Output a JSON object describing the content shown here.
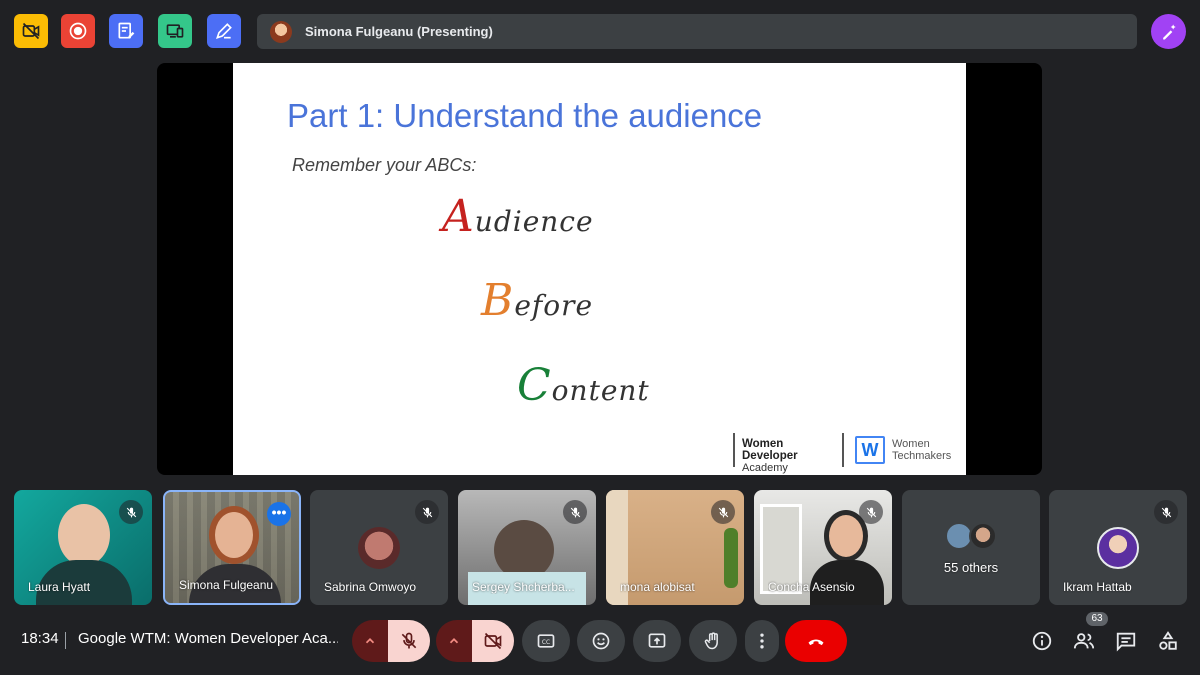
{
  "toolbar": {
    "buttons": [
      {
        "name": "no-video-icon",
        "color": "#fbbc04"
      },
      {
        "name": "record-icon",
        "color": "#ea4335"
      },
      {
        "name": "notes-icon",
        "color": "#4c6ef5"
      },
      {
        "name": "devices-icon",
        "color": "#34c78a"
      },
      {
        "name": "pen-icon",
        "color": "#4c6ef5"
      }
    ],
    "presenter": "Simona Fulgeanu (Presenting)",
    "magic_icon": "sparkle-pen-icon"
  },
  "slide": {
    "title": "Part 1: Understand the audience",
    "subtitle": "Remember your ABCs:",
    "abc": [
      {
        "cap": "A",
        "rest": "udience",
        "color": "#c5221f"
      },
      {
        "cap": "B",
        "rest": "efore",
        "color": "#e37f2e"
      },
      {
        "cap": "C",
        "rest": "ontent",
        "color": "#188038"
      }
    ],
    "logo_wda_line1": "Women Developer",
    "logo_wda_line2": "Academy",
    "logo_wtm_mark": "W",
    "logo_wtm_line1": "Women",
    "logo_wtm_line2": "Techmakers"
  },
  "participants": [
    {
      "name": "Laura Hyatt",
      "muted": true
    },
    {
      "name": "Simona Fulgeanu",
      "muted": false,
      "active": true
    },
    {
      "name": "Sabrina Omwoyo",
      "muted": true
    },
    {
      "name": "Sergey Shcherba...",
      "muted": true
    },
    {
      "name": "mona alobisat",
      "muted": true
    },
    {
      "name": "Concha Asensio",
      "muted": true
    },
    {
      "name": "55 others",
      "muted": false
    },
    {
      "name": "Ikram Hattab",
      "muted": true
    }
  ],
  "bottom": {
    "time": "18:34",
    "meeting": "Google WTM: Women Developer Aca...",
    "people_count": "63",
    "end_call_color": "#ea0000"
  }
}
